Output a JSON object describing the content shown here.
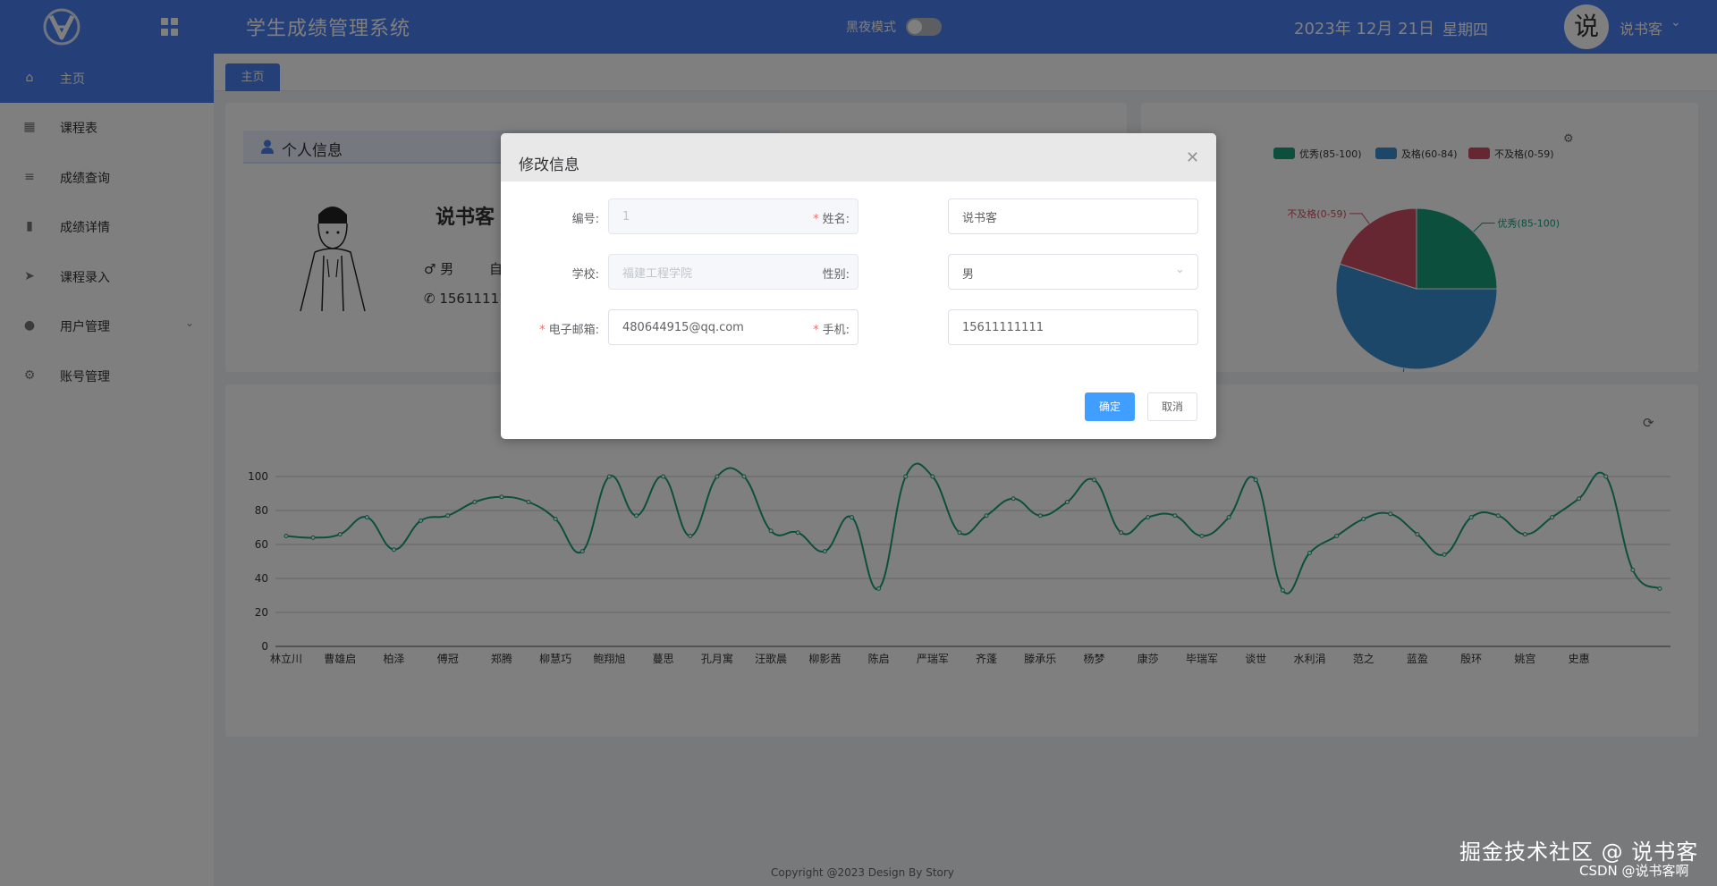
{
  "header": {
    "app_title": "学生成绩管理系统",
    "night_mode_label": "黑夜模式",
    "night_mode_on": false,
    "date": "2023年 12月 21日",
    "weekday": "星期四",
    "avatar_char": "说",
    "user_name": "说书客"
  },
  "sidebar": {
    "items": [
      {
        "label": "主页",
        "icon": "home-icon",
        "active": true
      },
      {
        "label": "课程表",
        "icon": "grid-icon"
      },
      {
        "label": "成绩查询",
        "icon": "list-icon"
      },
      {
        "label": "成绩详情",
        "icon": "bar-chart-icon"
      },
      {
        "label": "课程录入",
        "icon": "send-icon"
      },
      {
        "label": "用户管理",
        "icon": "user-icon",
        "has_submenu": true
      },
      {
        "label": "账号管理",
        "icon": "gear-icon"
      }
    ]
  },
  "tabs": [
    {
      "label": "主页"
    }
  ],
  "info_card": {
    "title": "个人信息",
    "name": "说书客",
    "gender": "♂ 男",
    "extra": "自",
    "phone": "15611111"
  },
  "pie_chart": {
    "legend": [
      "优秀(85-100)",
      "及格(60-84)",
      "不及格(0-59)"
    ],
    "colors": [
      "#1a9e7b",
      "#3a8ed0",
      "#cf4f64"
    ],
    "values": [
      25,
      55,
      20
    ],
    "labels": [
      "优秀(85-100)",
      "及格(60-84)",
      "不及格(0-59)"
    ]
  },
  "chart_data": {
    "type": "line",
    "title": "",
    "xlabel": "",
    "ylabel": "",
    "ylim": [
      0,
      100
    ],
    "yticks": [
      0,
      20,
      40,
      60,
      80,
      100
    ],
    "x": [
      "林立川",
      "",
      "曹雄启",
      "",
      "柏泽",
      "",
      "傅冠",
      "",
      "郑腾",
      "",
      "柳慧巧",
      "",
      "鲍翔旭",
      "",
      "蔓思",
      "",
      "孔月寓",
      "",
      "汪歌晨",
      "",
      "柳影茜",
      "",
      "陈启",
      "",
      "严瑞军",
      "",
      "齐蓬",
      "",
      "滕承乐",
      "",
      "杨梦",
      "",
      "康莎",
      "",
      "毕瑞军",
      "",
      "谈世",
      "",
      "水利涓",
      "",
      "范之",
      "",
      "蓝盈",
      "",
      "殷环",
      "",
      "姚宫",
      "",
      "史惠",
      ""
    ],
    "series": [
      {
        "name": "",
        "color": "#1a9e7b",
        "values": [
          65,
          64,
          66,
          76,
          57,
          74,
          77,
          85,
          88,
          85,
          75,
          56,
          100,
          77,
          100,
          65,
          100,
          100,
          68,
          67,
          56,
          76,
          34,
          100,
          100,
          67,
          77,
          87,
          77,
          85,
          98,
          67,
          76,
          77,
          65,
          76,
          98,
          33,
          55,
          65,
          75,
          78,
          66,
          54,
          76,
          77,
          66,
          76,
          87,
          100,
          45,
          34
        ]
      }
    ]
  },
  "footer": "Copyright @2023 Design By Story",
  "watermark": {
    "main": "掘金技术社区 @ 说书客",
    "sub": "CSDN @说书客啊"
  },
  "dialog": {
    "title": "修改信息",
    "fields": {
      "id": {
        "label": "编号:",
        "value": "1",
        "required": false,
        "disabled": true
      },
      "name": {
        "label": "姓名:",
        "value": "说书客",
        "required": true
      },
      "school": {
        "label": "学校:",
        "value": "福建工程学院",
        "required": false,
        "disabled": true
      },
      "gender": {
        "label": "性别:",
        "value": "男",
        "required": false
      },
      "email": {
        "label": "电子邮箱:",
        "value": "480644915@qq.com",
        "required": true
      },
      "phone": {
        "label": "手机:",
        "value": "15611111111",
        "required": true
      }
    },
    "confirm_label": "确定",
    "cancel_label": "取消"
  }
}
